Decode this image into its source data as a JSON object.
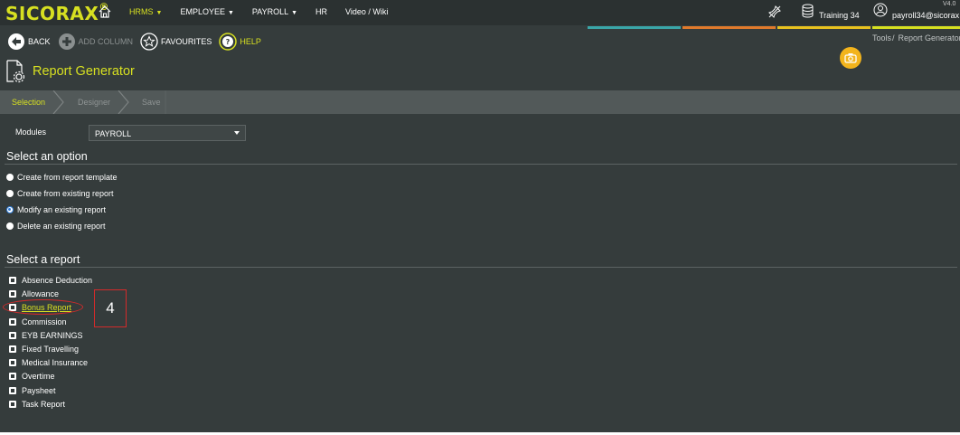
{
  "app": {
    "logo": "SICORAX",
    "logo_mark": "®",
    "version": "V4.0"
  },
  "nav": {
    "items": [
      {
        "label": "HRMS",
        "dropdown": true,
        "active": true
      },
      {
        "label": "EMPLOYEE",
        "dropdown": true,
        "active": false
      },
      {
        "label": "PAYROLL",
        "dropdown": true,
        "active": false
      },
      {
        "label": "HR",
        "dropdown": false,
        "active": false
      },
      {
        "label": "Video / Wiki",
        "dropdown": false,
        "active": false
      }
    ],
    "database": "Training 34",
    "user": "payroll34@sicorax",
    "caret": "▼"
  },
  "toolbar": {
    "back": "BACK",
    "add_column": "ADD COLUMN",
    "favourites": "FAVOURITES",
    "help": "HELP"
  },
  "breadcrumb": {
    "root": "Tools",
    "separator": "/",
    "current": "Report Generator"
  },
  "page": {
    "title": "Report Generator"
  },
  "wizard": {
    "steps": [
      "Selection",
      "Designer",
      "Save"
    ],
    "active_step": 0
  },
  "modules": {
    "label": "Modules",
    "value": "PAYROLL"
  },
  "options": {
    "title": "Select an option",
    "items": [
      {
        "label": "Create from report template",
        "checked": false
      },
      {
        "label": "Create from existing report",
        "checked": false
      },
      {
        "label": "Modify an existing report",
        "checked": true
      },
      {
        "label": "Delete an existing report",
        "checked": false
      }
    ]
  },
  "reports": {
    "title": "Select a report",
    "items": [
      {
        "label": "Absence Deduction",
        "highlight": false
      },
      {
        "label": "Allowance",
        "highlight": false
      },
      {
        "label": "Bonus Report",
        "highlight": true
      },
      {
        "label": "Commission",
        "highlight": false
      },
      {
        "label": "EYB EARNINGS",
        "highlight": false
      },
      {
        "label": "Fixed Travelling",
        "highlight": false
      },
      {
        "label": "Medical Insurance",
        "highlight": false
      },
      {
        "label": "Overtime",
        "highlight": false
      },
      {
        "label": "Paysheet",
        "highlight": false
      },
      {
        "label": "Task Report",
        "highlight": false
      }
    ]
  },
  "annotation": {
    "step_number": "4"
  },
  "colors": {
    "accent": "#d7e021",
    "background": "#353c3c",
    "strip": [
      "#3aa6a8",
      "#e07a2c",
      "#e8c21f",
      "#d7e021"
    ],
    "annotation": "#d42a2a"
  }
}
